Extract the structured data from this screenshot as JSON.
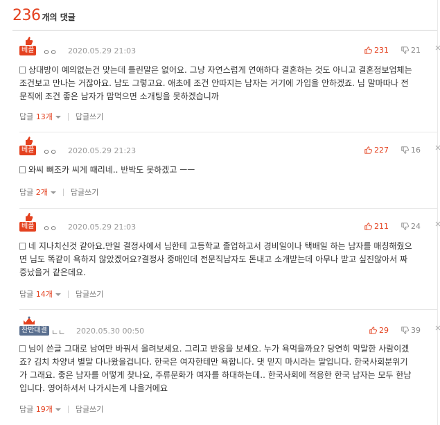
{
  "header": {
    "count": "236",
    "label": "개의 댓글"
  },
  "comments": [
    {
      "badge": "베플",
      "author": "ㅇㅇ",
      "time": "2020.05.29 21:03",
      "likes": "231",
      "dislikes": "21",
      "text": "상대방이 예의없는건 맞는데 틀린말은 없어요. 그냥 자연스럽게 연애하다 결혼하는 것도 아니고 결혼정보업체는 조건보고 만나는 거잖아요. 남도 그렇고요. 애초에 조건 안따지는 남자는 거기에 가입을 안하겠죠. 님 말마따나 전문직에 조건 좋은 남자가 맘먹으면 소개팅을 못하겠습니까",
      "reply_label": "답글",
      "reply_count": "13개",
      "write_label": "답글쓰기"
    },
    {
      "badge": "베플",
      "author": "ㅇㅇ",
      "time": "2020.05.29 21:23",
      "likes": "227",
      "dislikes": "16",
      "text": "와씨 뼈조카 씨게 때리네.. 반박도 못하겠고 ㅡㅡ",
      "reply_label": "답글",
      "reply_count": "2개",
      "write_label": "답글쓰기"
    },
    {
      "badge": "베플",
      "author": "ㅇㅇ",
      "time": "2020.05.29 21:03",
      "likes": "211",
      "dislikes": "24",
      "text": "네 지나치신것 같아요.만일 결정사에서 님한테 고등학교 졸업하고서 경비일이나 택배일 하는 남자를 매칭해줬으면 님도 똑같이 욕하지 않았겠어요?결정사 중매인데 전문직남자도 돈내고 소개받는데 아무나 받고 싶진않아서 짜증났을거 같은데요.",
      "reply_label": "답글",
      "reply_count": "14개",
      "write_label": "답글쓰기"
    },
    {
      "badge": "찬반대결",
      "author": "ㄴㄴ",
      "time": "2020.05.30 00:50",
      "likes": "29",
      "dislikes": "39",
      "text": "님이 쓴글 그대로 남여만 바꿔서 올려보세요. 그리고 반응을 보세요. 누가 욕먹을까요? 당연히 막말한 사람이겠죠? 김치 차양녀 별말 다나왔을겁니다. 한국은 여자한테만 욕합니다. 댓 믿지 마시라는 말입니다. 한국사회분위기가 그래요. 좋은 남자를 어떻게 찾나요, 주류문화가 여자를 하대하는데.. 한국사회에 적응한 한국 남자는 모두 한남입니다. 영어하셔서 나가시는게 나을거에요",
      "reply_label": "답글",
      "reply_count": "19개",
      "write_label": "답글쓰기"
    }
  ],
  "colors": {
    "accent": "#e4411f",
    "badge_gray": "#5a6f8f",
    "divider": "#e6e6e6"
  },
  "icons": {
    "like": "thumbs-up-icon",
    "dislike": "thumbs-down-icon",
    "more": "more-icon",
    "doc": "doc-icon",
    "badge": "crown-icon"
  }
}
